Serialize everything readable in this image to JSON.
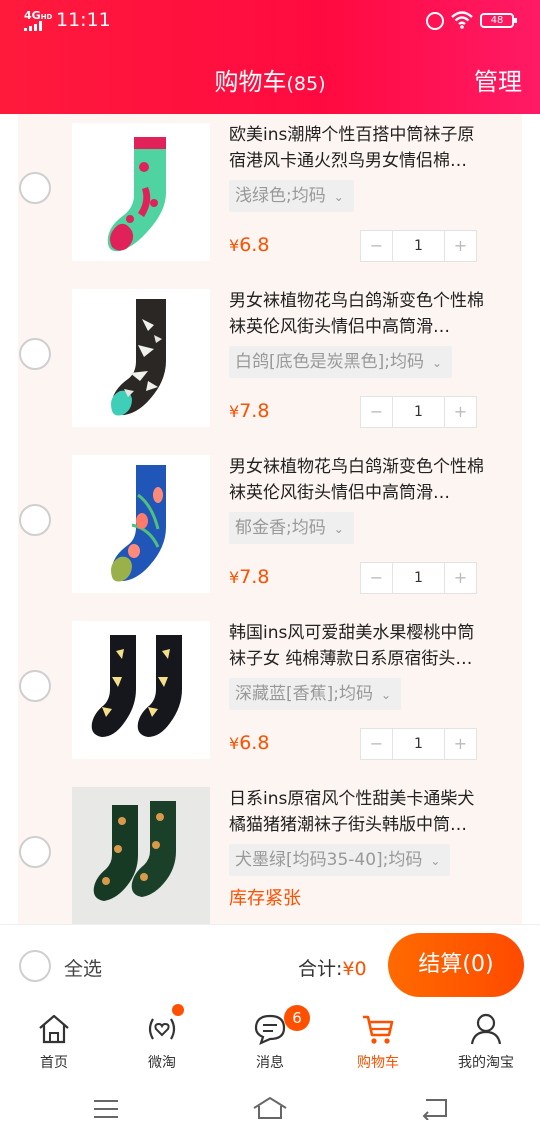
{
  "status_bar": {
    "network": "4G",
    "network_hd": "HD",
    "time": "11:11",
    "battery": "48"
  },
  "header": {
    "title": "购物车",
    "count": "(85)",
    "manage": "管理"
  },
  "items": [
    {
      "name": "欧美ins潮牌个性百搭中筒袜子原宿港风卡通火烈鸟男女情侣棉…",
      "sku": "浅绿色;均码",
      "currency": "¥",
      "price": "6.8",
      "qty": "1",
      "image": "flamingo-sock-image"
    },
    {
      "name": "男女袜植物花鸟白鸽渐变色个性棉袜英伦风街头情侣中高筒滑…",
      "sku": "白鸽[底色是炭黑色];均码",
      "currency": "¥",
      "price": "7.8",
      "qty": "1",
      "image": "dove-sock-image"
    },
    {
      "name": "男女袜植物花鸟白鸽渐变色个性棉袜英伦风街头情侣中高筒滑…",
      "sku": "郁金香;均码",
      "currency": "¥",
      "price": "7.8",
      "qty": "1",
      "image": "tulip-sock-image"
    },
    {
      "name": "韩国ins风可爱甜美水果樱桃中筒袜子女 纯棉薄款日系原宿街头…",
      "sku": "深藏蓝[香蕉];均码",
      "currency": "¥",
      "price": "6.8",
      "qty": "1",
      "image": "banana-sock-image"
    },
    {
      "name": "日系ins原宿风个性甜美卡通柴犬橘猫猪猪潮袜子街头韩版中筒…",
      "sku": "犬墨绿[均码35-40];均码",
      "stock_note": "库存紧张",
      "image": "shiba-sock-image"
    }
  ],
  "stepper": {
    "minus": "−",
    "plus": "+"
  },
  "bottom_bar": {
    "select_all": "全选",
    "total_label": "合计:",
    "total_amount": "¥0",
    "checkout": "结算(0)"
  },
  "tabs": [
    {
      "label": "首页",
      "icon": "home-icon"
    },
    {
      "label": "微淘",
      "icon": "weitao-icon"
    },
    {
      "label": "消息",
      "icon": "message-icon",
      "badge": "6"
    },
    {
      "label": "购物车",
      "icon": "cart-icon",
      "active": true
    },
    {
      "label": "我的淘宝",
      "icon": "profile-icon"
    }
  ],
  "colors": {
    "header_red": "#ff0a40",
    "accent_orange": "#ff5000",
    "panel_bg": "#fdf5f1"
  }
}
